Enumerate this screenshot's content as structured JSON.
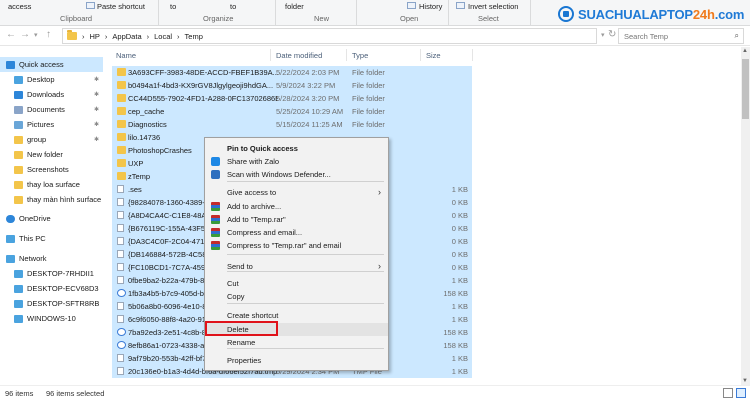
{
  "ribbon": {
    "items": [
      "access",
      "Paste shortcut",
      "to",
      "to",
      "folder",
      "History",
      "Invert selection"
    ],
    "groups": [
      "Clipboard",
      "Organize",
      "New",
      "Open",
      "Select"
    ]
  },
  "logo": {
    "part1": "SUACHUALAPTOP",
    "part2": "24h",
    "part3": ".com"
  },
  "address": {
    "crumbs": [
      "HP",
      "AppData",
      "Local",
      "Temp"
    ],
    "search_placeholder": "Search Temp"
  },
  "nav": {
    "items": [
      {
        "label": "Quick access",
        "icon": "star-icon",
        "pinned": false
      },
      {
        "label": "Desktop",
        "icon": "desktop-icon",
        "pinned": true
      },
      {
        "label": "Downloads",
        "icon": "download-icon",
        "pinned": true
      },
      {
        "label": "Documents",
        "icon": "documents-icon",
        "pinned": true
      },
      {
        "label": "Pictures",
        "icon": "pictures-icon",
        "pinned": true
      },
      {
        "label": "group",
        "icon": "folder-icon",
        "pinned": true
      },
      {
        "label": "New folder",
        "icon": "folder-icon",
        "pinned": false
      },
      {
        "label": "Screenshots",
        "icon": "folder-icon",
        "pinned": false
      },
      {
        "label": "thay loa surface",
        "icon": "folder-icon",
        "pinned": false
      },
      {
        "label": "thay màn hình surface",
        "icon": "folder-icon",
        "pinned": false
      },
      {
        "label": "OneDrive",
        "icon": "cloud-icon",
        "pinned": false
      },
      {
        "label": "This PC",
        "icon": "pc-icon",
        "pinned": false
      },
      {
        "label": "Network",
        "icon": "network-icon",
        "pinned": false
      },
      {
        "label": "DESKTOP-7RHDII1",
        "icon": "computer-icon",
        "pinned": false
      },
      {
        "label": "DESKTOP-ECV68D3",
        "icon": "computer-icon",
        "pinned": false
      },
      {
        "label": "DESKTOP-SFTR8RB",
        "icon": "computer-icon",
        "pinned": false
      },
      {
        "label": "WINDOWS-10",
        "icon": "computer-icon",
        "pinned": false
      }
    ]
  },
  "columns": {
    "name": "Name",
    "date": "Date modified",
    "type": "Type",
    "size": "Size"
  },
  "files": [
    {
      "name": "3A693CFF-3983-48DE-ACCD-FBEF1B39A...",
      "date": "5/22/2024 2:03 PM",
      "type": "File folder",
      "size": "",
      "kind": "folder"
    },
    {
      "name": "b0494a1f-4bd3-KX9rGV8Jlgylgeoji9hdGA...",
      "date": "5/9/2024 3:22 PM",
      "type": "File folder",
      "size": "",
      "kind": "folder"
    },
    {
      "name": "CC44D555-7902-4FD1-A288-0FC13702686E",
      "date": "5/28/2024 3:20 PM",
      "type": "File folder",
      "size": "",
      "kind": "folder"
    },
    {
      "name": "cep_cache",
      "date": "5/25/2024 10:29 AM",
      "type": "File folder",
      "size": "",
      "kind": "folder"
    },
    {
      "name": "Diagnostics",
      "date": "5/15/2024 11:25 AM",
      "type": "File folder",
      "size": "",
      "kind": "folder"
    },
    {
      "name": "lilo.14736",
      "date": "",
      "type": "",
      "size": "",
      "kind": "folder"
    },
    {
      "name": "PhotoshopCrashes",
      "date": "",
      "type": "",
      "size": "",
      "kind": "folder"
    },
    {
      "name": "UXP",
      "date": "",
      "type": "",
      "size": "",
      "kind": "folder"
    },
    {
      "name": "zTemp",
      "date": "",
      "type": "",
      "size": "",
      "kind": "folder"
    },
    {
      "name": ".ses",
      "date": "",
      "type": "",
      "size": "1 KB",
      "kind": "file"
    },
    {
      "name": "{98284078-1360-4389-8a",
      "date": "",
      "type": "",
      "size": "0 KB",
      "kind": "file"
    },
    {
      "name": "{A8D4CA4C-C1E8-48A1",
      "date": "",
      "type": "",
      "size": "0 KB",
      "kind": "file"
    },
    {
      "name": "{B676119C-155A-43F5-8",
      "date": "",
      "type": "",
      "size": "0 KB",
      "kind": "file"
    },
    {
      "name": "{DA3C4C0F-2C04-4714-",
      "date": "",
      "type": "",
      "size": "0 KB",
      "kind": "file"
    },
    {
      "name": "{DB146884-572B-4C58-8",
      "date": "",
      "type": "",
      "size": "0 KB",
      "kind": "file"
    },
    {
      "name": "{FC10BCD1-7C7A-4597-",
      "date": "",
      "type": "",
      "size": "0 KB",
      "kind": "file"
    },
    {
      "name": "0fbe9ba2-b22a-479b-88",
      "date": "",
      "type": "",
      "size": "1 KB",
      "kind": "file"
    },
    {
      "name": "1fb3a4b5-b7c9-405d-b6",
      "date": "",
      "type": "",
      "size": "158 KB",
      "kind": "edge"
    },
    {
      "name": "5b06a8b0-6096-4e10-84",
      "date": "",
      "type": "",
      "size": "1 KB",
      "kind": "file"
    },
    {
      "name": "6c9f6050-88f8-4a20-91",
      "date": "",
      "type": "",
      "size": "1 KB",
      "kind": "file"
    },
    {
      "name": "7ba92ed3-2e51-4c8b-8",
      "date": "",
      "type": "",
      "size": "158 KB",
      "kind": "edge"
    },
    {
      "name": "8efb86a1-0723-4338-afl",
      "date": "",
      "type": "",
      "size": "158 KB",
      "kind": "edge"
    },
    {
      "name": "9af79b20-553b-42ff-bf7",
      "date": "",
      "type": "",
      "size": "1 KB",
      "kind": "file"
    },
    {
      "name": "20c136e0-b1a3-4d4d-bf6a-df66ef52f7ad.tmp",
      "date": "5/29/2024 2:34 PM",
      "type": "TMP File",
      "size": "1 KB",
      "kind": "file"
    }
  ],
  "context_menu": {
    "items": [
      {
        "label": "Pin to Quick access",
        "bold": true,
        "icon": "",
        "submenu": false
      },
      {
        "label": "Share with Zalo",
        "bold": false,
        "icon": "zalo-icon",
        "submenu": false
      },
      {
        "label": "Scan with Windows Defender...",
        "bold": false,
        "icon": "defender-icon",
        "submenu": false
      },
      {
        "label": "Give access to",
        "bold": false,
        "icon": "",
        "submenu": true
      },
      {
        "label": "Add to archive...",
        "bold": false,
        "icon": "winrar-icon",
        "submenu": false
      },
      {
        "label": "Add to \"Temp.rar\"",
        "bold": false,
        "icon": "winrar-icon",
        "submenu": false
      },
      {
        "label": "Compress and email...",
        "bold": false,
        "icon": "winrar-icon",
        "submenu": false
      },
      {
        "label": "Compress to \"Temp.rar\" and email",
        "bold": false,
        "icon": "winrar-icon",
        "submenu": false
      },
      {
        "label": "Send to",
        "bold": false,
        "icon": "",
        "submenu": true
      },
      {
        "label": "Cut",
        "bold": false,
        "icon": "",
        "submenu": false
      },
      {
        "label": "Copy",
        "bold": false,
        "icon": "",
        "submenu": false
      },
      {
        "label": "Create shortcut",
        "bold": false,
        "icon": "",
        "submenu": false
      },
      {
        "label": "Delete",
        "bold": false,
        "icon": "",
        "submenu": false
      },
      {
        "label": "Rename",
        "bold": false,
        "icon": "",
        "submenu": false
      },
      {
        "label": "Properties",
        "bold": false,
        "icon": "",
        "submenu": false
      }
    ],
    "highlighted": "Delete"
  },
  "status": {
    "count": "96 items",
    "selected": "96 items selected"
  },
  "colors": {
    "selection": "#cce8ff",
    "highlight_box": "#e0121a",
    "folder": "#f3c54a"
  }
}
